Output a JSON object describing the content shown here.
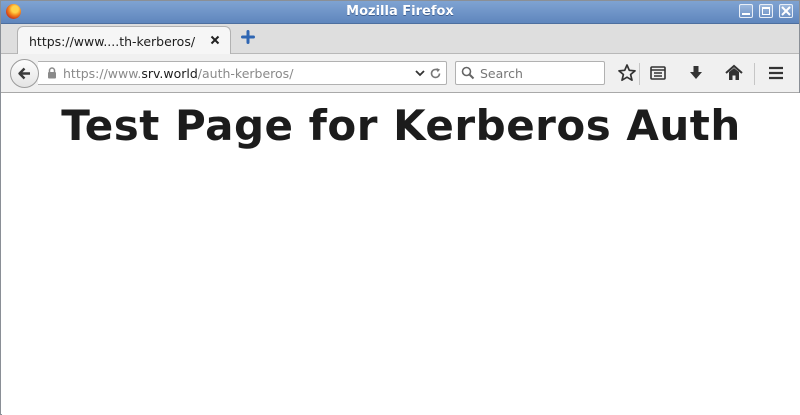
{
  "window": {
    "title": "Mozilla Firefox"
  },
  "tabs": [
    {
      "title": "https://www....th-kerberos/"
    }
  ],
  "navbar": {
    "url": {
      "scheme": "https://www.",
      "host": "srv.world",
      "path": "/auth-kerberos/"
    },
    "search": {
      "placeholder": "Search"
    }
  },
  "page": {
    "heading": "Test Page for Kerberos Auth"
  },
  "colors": {
    "titlebar": "#6b8fc4",
    "chrome": "#f0f0f0",
    "text": "#1c1c1c"
  },
  "icons": [
    "firefox-logo",
    "minimize-icon",
    "maximize-icon",
    "close-icon",
    "tab-close-icon",
    "new-tab-icon",
    "back-arrow-icon",
    "lock-icon",
    "dropdown-icon",
    "reload-icon",
    "search-icon",
    "bookmark-star-icon",
    "reading-list-icon",
    "download-icon",
    "home-icon",
    "menu-icon"
  ]
}
